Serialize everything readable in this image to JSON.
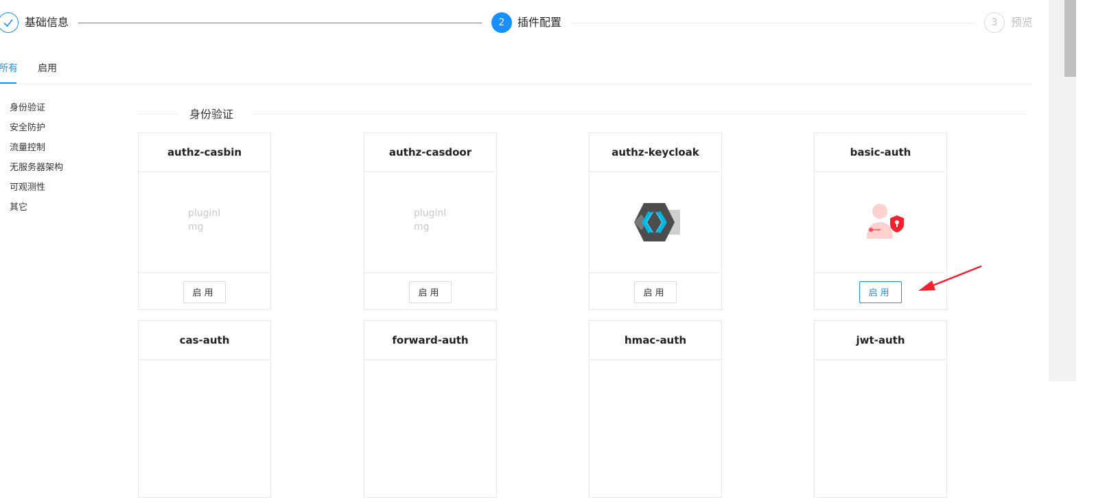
{
  "steps": [
    {
      "title": "基础信息",
      "state": "done"
    },
    {
      "number": "2",
      "title": "插件配置",
      "state": "active"
    },
    {
      "number": "3",
      "title": "预览",
      "state": "wait"
    }
  ],
  "tabs": [
    {
      "label": "所有",
      "active": true
    },
    {
      "label": "启用",
      "active": false
    }
  ],
  "categories": [
    "身份验证",
    "安全防护",
    "流量控制",
    "无服务器架构",
    "可观测性",
    "其它"
  ],
  "section": {
    "title": "身份验证"
  },
  "plugins": [
    {
      "name": "authz-casbin",
      "image": "broken",
      "alt": "pluginImg",
      "button": "启用"
    },
    {
      "name": "authz-casdoor",
      "image": "broken",
      "alt": "pluginImg",
      "button": "启用"
    },
    {
      "name": "authz-keycloak",
      "image": "keycloak-icon",
      "button": "启用"
    },
    {
      "name": "basic-auth",
      "image": "user-shield-icon",
      "button": "启用",
      "highlighted": true
    },
    {
      "name": "cas-auth"
    },
    {
      "name": "forward-auth"
    },
    {
      "name": "hmac-auth"
    },
    {
      "name": "jwt-auth"
    }
  ],
  "colors": {
    "primary": "#1890ff",
    "annotation": "#f5222d",
    "border": "#e8e8e8"
  }
}
